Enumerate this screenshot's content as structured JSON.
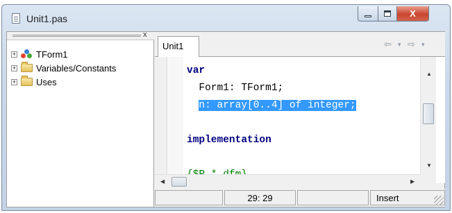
{
  "window": {
    "title": "Unit1.pas",
    "close_glyph": "X"
  },
  "explorer": {
    "close_glyph": "x",
    "items": [
      {
        "label": "TForm1",
        "icon": "class-icon"
      },
      {
        "label": "Variables/Constants",
        "icon": "folder-icon"
      },
      {
        "label": "Uses",
        "icon": "folder-icon"
      }
    ],
    "expander_glyph": "+"
  },
  "editor": {
    "tab_label": "Unit1",
    "code": {
      "line1": "var",
      "line2": "  Form1: TForm1;",
      "line3_indent": "  ",
      "line3_selected": "n: array[0..4] of integer;",
      "line4": "",
      "line5": "implementation",
      "line6": "",
      "line7": "{$R *.dfm}"
    }
  },
  "statusbar": {
    "position": "29: 29",
    "mode": "Insert"
  }
}
